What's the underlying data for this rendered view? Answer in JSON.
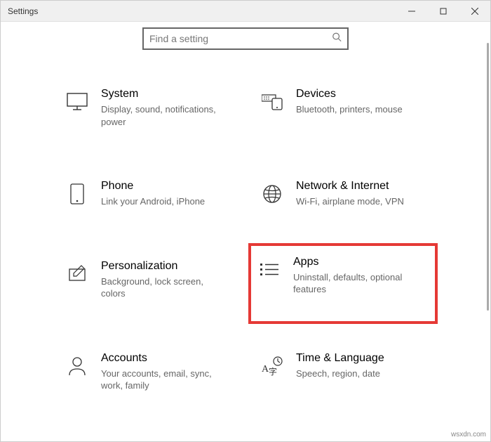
{
  "window": {
    "title": "Settings"
  },
  "search": {
    "placeholder": "Find a setting"
  },
  "tiles": {
    "system": {
      "title": "System",
      "desc": "Display, sound, notifications, power"
    },
    "devices": {
      "title": "Devices",
      "desc": "Bluetooth, printers, mouse"
    },
    "phone": {
      "title": "Phone",
      "desc": "Link your Android, iPhone"
    },
    "network": {
      "title": "Network & Internet",
      "desc": "Wi-Fi, airplane mode, VPN"
    },
    "personal": {
      "title": "Personalization",
      "desc": "Background, lock screen, colors"
    },
    "apps": {
      "title": "Apps",
      "desc": "Uninstall, defaults, optional features"
    },
    "accounts": {
      "title": "Accounts",
      "desc": "Your accounts, email, sync, work, family"
    },
    "time": {
      "title": "Time & Language",
      "desc": "Speech, region, date"
    }
  },
  "watermark": "wsxdn.com"
}
